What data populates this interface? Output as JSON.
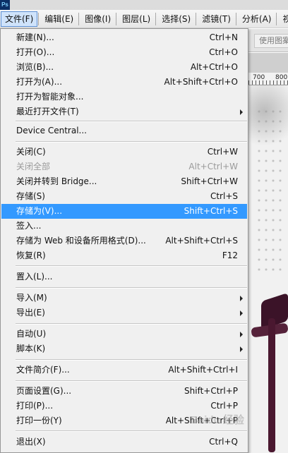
{
  "app": {
    "logo_text": "Ps"
  },
  "menubar": {
    "items": [
      {
        "label": "文件(F)"
      },
      {
        "label": "编辑(E)"
      },
      {
        "label": "图像(I)"
      },
      {
        "label": "图层(L)"
      },
      {
        "label": "选择(S)"
      },
      {
        "label": "滤镜(T)"
      },
      {
        "label": "分析(A)"
      },
      {
        "label": "视图(V"
      }
    ]
  },
  "options_bar": {
    "button_label": "使用图案"
  },
  "ruler": {
    "labels": [
      "700",
      "800"
    ]
  },
  "file_menu": {
    "items": [
      {
        "label": "新建(N)...",
        "shortcut": "Ctrl+N"
      },
      {
        "label": "打开(O)...",
        "shortcut": "Ctrl+O"
      },
      {
        "label": "浏览(B)...",
        "shortcut": "Alt+Ctrl+O"
      },
      {
        "label": "打开为(A)...",
        "shortcut": "Alt+Shift+Ctrl+O"
      },
      {
        "label": "打开为智能对象...",
        "shortcut": ""
      },
      {
        "label": "最近打开文件(T)",
        "shortcut": ""
      },
      {
        "label": "Device Central...",
        "shortcut": ""
      },
      {
        "label": "关闭(C)",
        "shortcut": "Ctrl+W"
      },
      {
        "label": "关闭全部",
        "shortcut": "Alt+Ctrl+W"
      },
      {
        "label": "关闭并转到 Bridge...",
        "shortcut": "Shift+Ctrl+W"
      },
      {
        "label": "存储(S)",
        "shortcut": "Ctrl+S"
      },
      {
        "label": "存储为(V)...",
        "shortcut": "Shift+Ctrl+S"
      },
      {
        "label": "签入...",
        "shortcut": ""
      },
      {
        "label": "存储为 Web 和设备所用格式(D)...",
        "shortcut": "Alt+Shift+Ctrl+S"
      },
      {
        "label": "恢复(R)",
        "shortcut": "F12"
      },
      {
        "label": "置入(L)...",
        "shortcut": ""
      },
      {
        "label": "导入(M)",
        "shortcut": ""
      },
      {
        "label": "导出(E)",
        "shortcut": ""
      },
      {
        "label": "自动(U)",
        "shortcut": ""
      },
      {
        "label": "脚本(K)",
        "shortcut": ""
      },
      {
        "label": "文件简介(F)...",
        "shortcut": "Alt+Shift+Ctrl+I"
      },
      {
        "label": "页面设置(G)...",
        "shortcut": "Shift+Ctrl+P"
      },
      {
        "label": "打印(P)...",
        "shortcut": "Ctrl+P"
      },
      {
        "label": "打印一份(Y)",
        "shortcut": "Alt+Shift+Ctrl+P"
      },
      {
        "label": "退出(X)",
        "shortcut": "Ctrl+Q"
      }
    ]
  },
  "watermark": {
    "text": "Baidu 经验"
  }
}
